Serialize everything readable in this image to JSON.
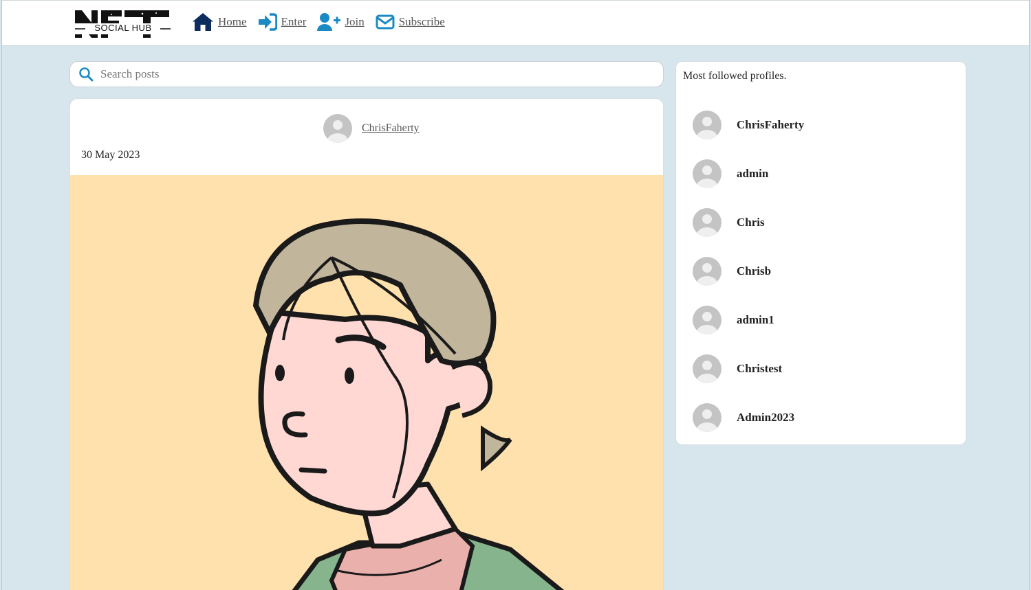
{
  "header": {
    "logo_text_top": "NFT",
    "logo_text_sub": "SOCIAL HUB",
    "nav": [
      {
        "label": "Home",
        "icon": "home-icon"
      },
      {
        "label": "Enter",
        "icon": "sign-in-icon"
      },
      {
        "label": "Join",
        "icon": "user-plus-icon"
      },
      {
        "label": "Subscribe",
        "icon": "envelope-icon"
      }
    ]
  },
  "search": {
    "placeholder": "Search posts",
    "icon": "search-icon"
  },
  "post": {
    "author": "ChrisFaherty",
    "date": "30 May 2023",
    "image_description_icon": "cartoon-portrait-image"
  },
  "sidebar": {
    "title": "Most followed profiles.",
    "profiles": [
      {
        "name": "ChrisFaherty"
      },
      {
        "name": "admin"
      },
      {
        "name": "Chris"
      },
      {
        "name": "Chrisb"
      },
      {
        "name": "admin1"
      },
      {
        "name": "Christest"
      },
      {
        "name": "Admin2023"
      }
    ]
  },
  "colors": {
    "page_bg": "#d6e6ec",
    "home_icon": "#0d2d5e",
    "nav_icon": "#1b8ac4",
    "image_bg": "#ffe1ad"
  }
}
